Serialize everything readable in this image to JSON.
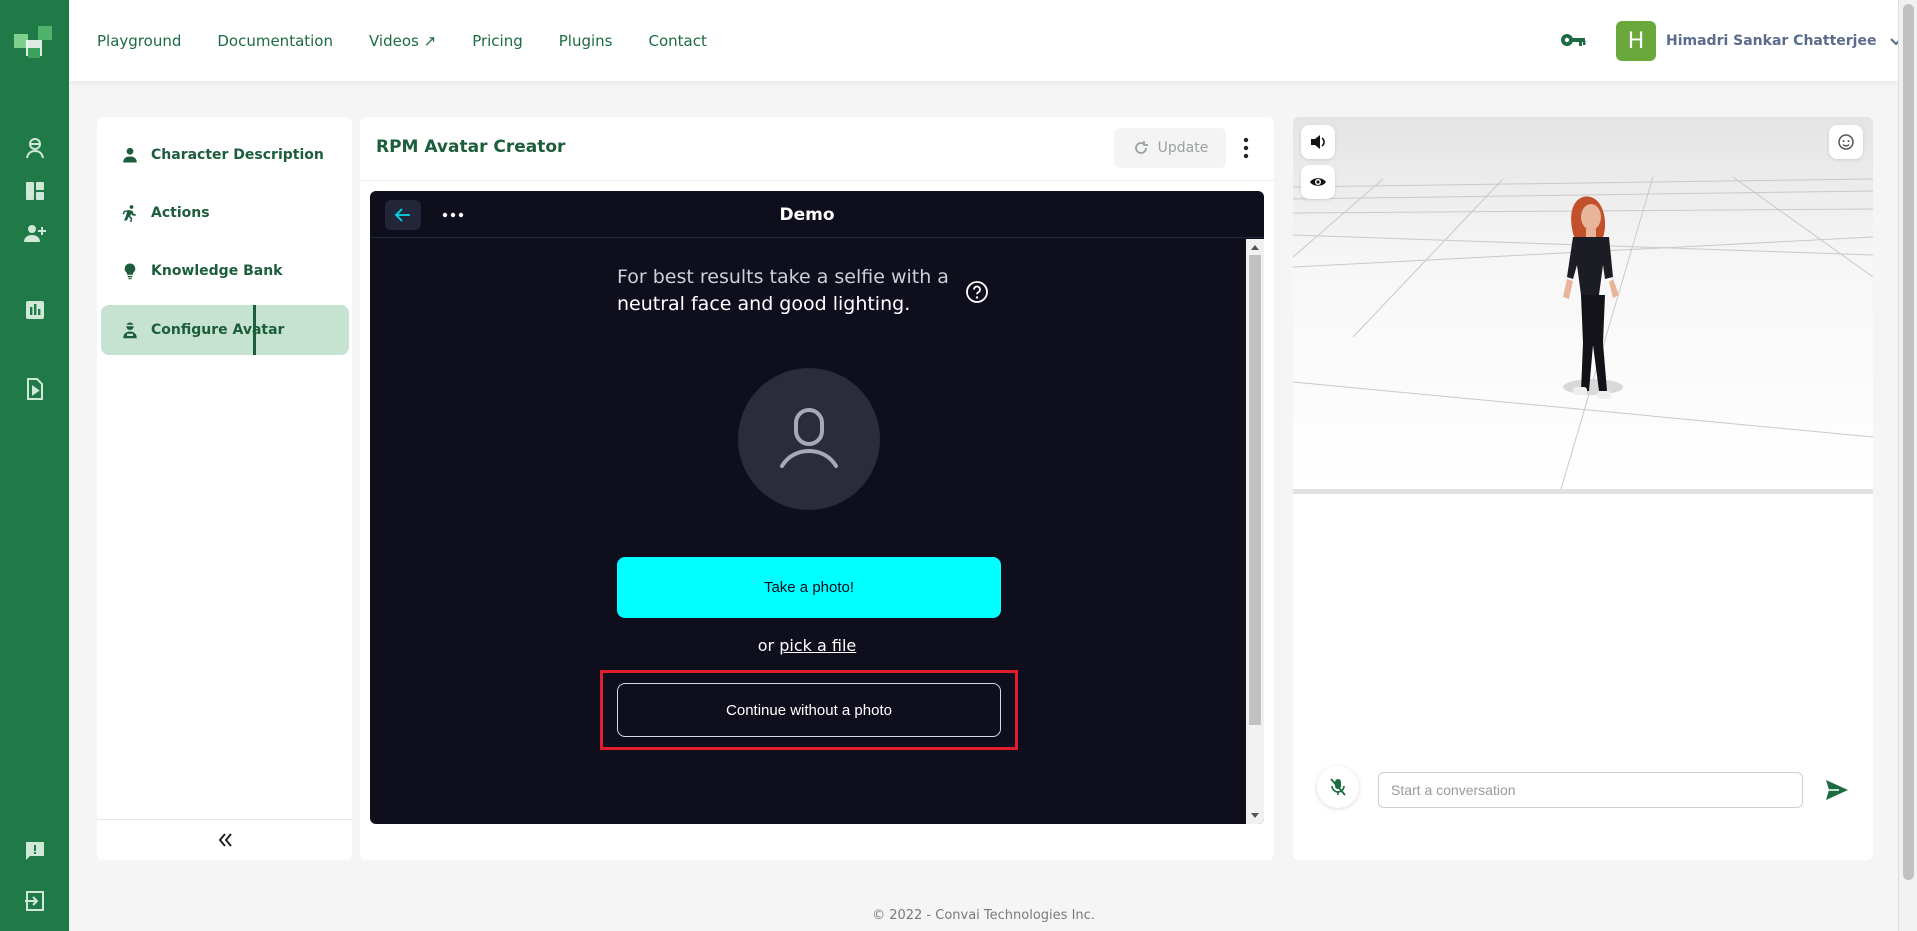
{
  "topbar": {
    "nav": [
      "Playground",
      "Documentation",
      "Videos ↗",
      "Pricing",
      "Plugins",
      "Contact"
    ],
    "user_initial": "H",
    "user_name": "Himadri Sankar Chatterjee"
  },
  "sidebar": {
    "items": [
      {
        "label": "Character Description",
        "icon": "person-icon"
      },
      {
        "label": "Actions",
        "icon": "running-icon"
      },
      {
        "label": "Knowledge Bank",
        "icon": "lightbulb-icon"
      },
      {
        "label": "Configure Avatar",
        "icon": "avatar-config-icon",
        "active": true
      }
    ],
    "collapse_glyph": "«"
  },
  "center": {
    "title": "RPM Avatar Creator",
    "update_label": "Update",
    "frame": {
      "title": "Demo",
      "hint_line1": "For best results take a selfie with a",
      "hint_line2": "neutral face and good lighting.",
      "take_photo_label": "Take a photo!",
      "or_text": "or ",
      "pick_file_label": "pick a file",
      "continue_label": "Continue without a photo"
    }
  },
  "right": {
    "placeholder": "Start a conversation"
  },
  "footer": {
    "text": "© 2022 - Convai Technologies Inc."
  },
  "colors": {
    "brand": "#1f7a48",
    "accent_cyan": "#00ffff",
    "highlight": "#e01e2d",
    "frame_bg": "#0e0e1c"
  }
}
